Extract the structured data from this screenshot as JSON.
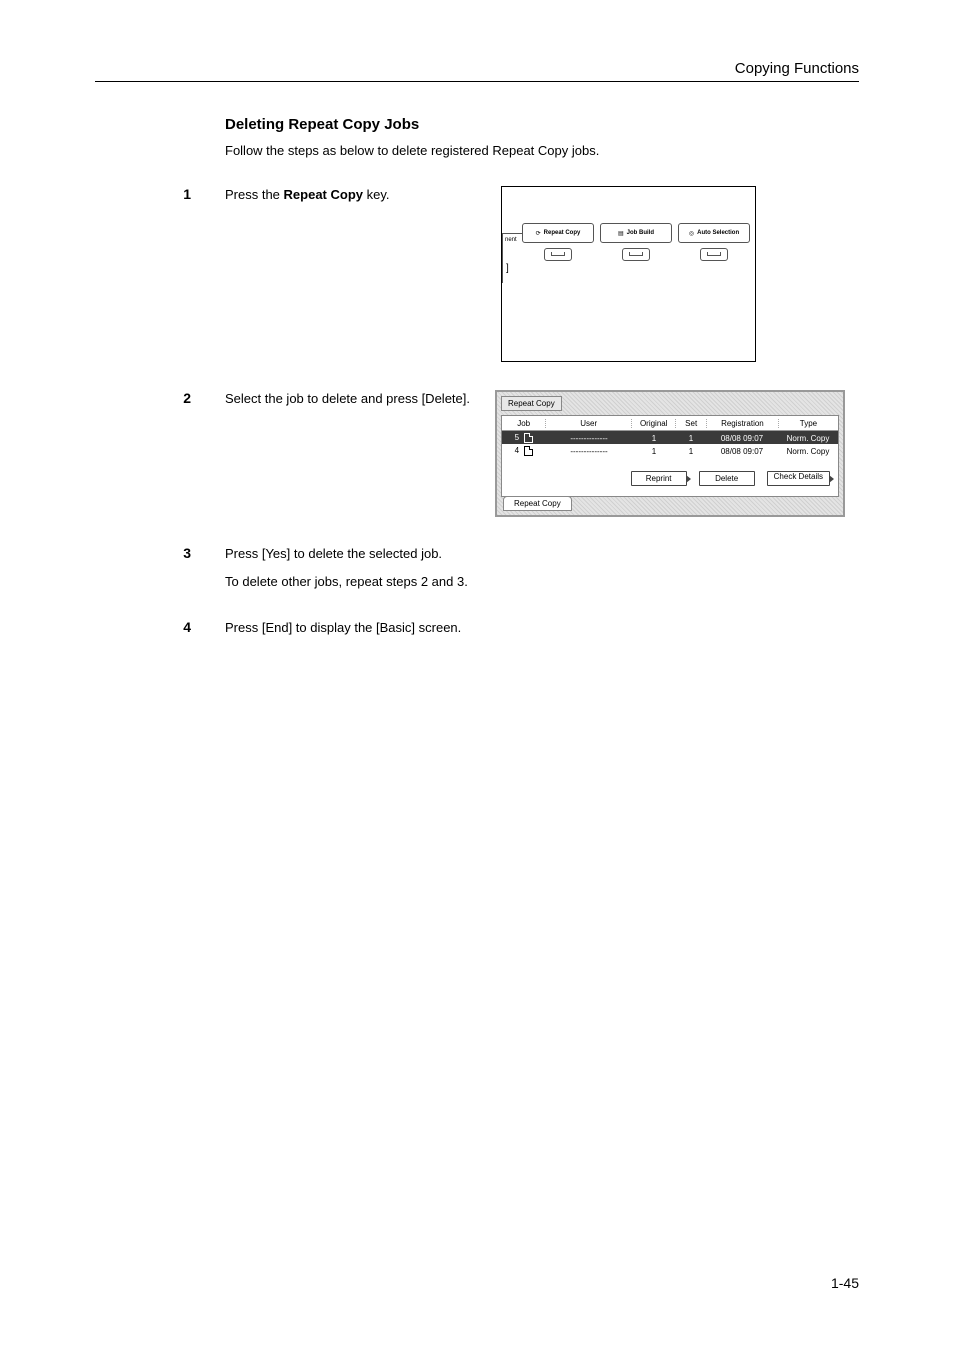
{
  "header": {
    "running_title": "Copying Functions"
  },
  "section": {
    "title": "Deleting Repeat Copy Jobs",
    "intro": "Follow the steps as below to delete registered Repeat Copy jobs."
  },
  "steps": [
    {
      "num": "1",
      "text_pre": "Press the ",
      "text_bold": "Repeat Copy",
      "text_post": " key."
    },
    {
      "num": "2",
      "text": "Select the job to delete and press [Delete]."
    },
    {
      "num": "3",
      "text_a": "Press [Yes] to delete the selected job.",
      "text_b": "To delete other jobs, repeat steps 2 and 3."
    },
    {
      "num": "4",
      "text": "Press [End] to display the [Basic] screen."
    }
  ],
  "panel": {
    "left_fragment_label": "nent",
    "buttons": [
      {
        "glyph": "⟳",
        "label": "Repeat Copy"
      },
      {
        "glyph": "▤",
        "label": "Job Build"
      },
      {
        "glyph": "◎",
        "label": "Auto Selection"
      }
    ]
  },
  "screen": {
    "title": "Repeat Copy",
    "tab_label": "Repeat Copy",
    "columns": {
      "job": "Job",
      "user": "User",
      "original": "Original",
      "set": "Set",
      "registration": "Registration",
      "type": "Type"
    },
    "buttons": {
      "reprint": "Reprint",
      "delete": "Delete",
      "check": "Check Details"
    },
    "rows": [
      {
        "job": "5",
        "user": "--------------",
        "original": "1",
        "set": "1",
        "registration": "08/08  09:07",
        "type": "Norm. Copy",
        "selected": true
      },
      {
        "job": "4",
        "user": "--------------",
        "original": "1",
        "set": "1",
        "registration": "08/08  09:07",
        "type": "Norm. Copy",
        "selected": false
      }
    ]
  },
  "page_number": "1-45"
}
